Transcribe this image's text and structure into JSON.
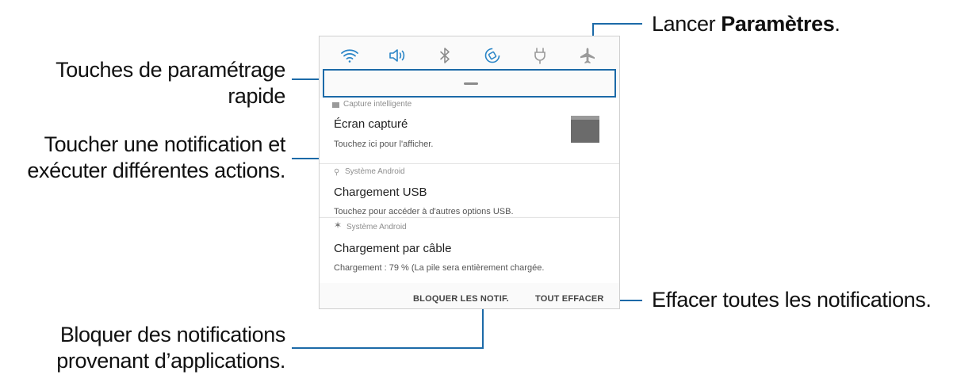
{
  "callouts": {
    "quick_settings": [
      "Touches de paramétrage",
      "rapide"
    ],
    "tap_notification": [
      "Toucher une notification et",
      "exécuter différentes actions."
    ],
    "block_notifications": [
      "Bloquer des notifications",
      "provenant d’applications."
    ],
    "launch_settings_prefix": "Lancer ",
    "launch_settings_bold": "Paramètres",
    "launch_settings_suffix": ".",
    "clear_all": "Effacer toutes les notifications."
  },
  "quick_settings_icons": [
    "wifi-icon",
    "sound-icon",
    "bluetooth-icon",
    "auto-rotate-icon",
    "power-saving-icon",
    "airplane-mode-icon"
  ],
  "notifications": [
    {
      "app": "Capture intelligente",
      "title": "Écran capturé",
      "body": "Touchez ici pour l'afficher."
    },
    {
      "app": "Système Android",
      "title": "Chargement USB",
      "body": "Touchez pour accéder à d'autres options USB."
    },
    {
      "app": "Système Android",
      "title": "Chargement par câble",
      "body": "Chargement : 79 % (La pile sera entièrement chargée."
    }
  ],
  "actions": {
    "block": "BLOQUER LES NOTIF.",
    "clear": "TOUT EFFACER"
  },
  "colors": {
    "accent": "#1c6aa8",
    "qs_active": "#2a85c7"
  }
}
